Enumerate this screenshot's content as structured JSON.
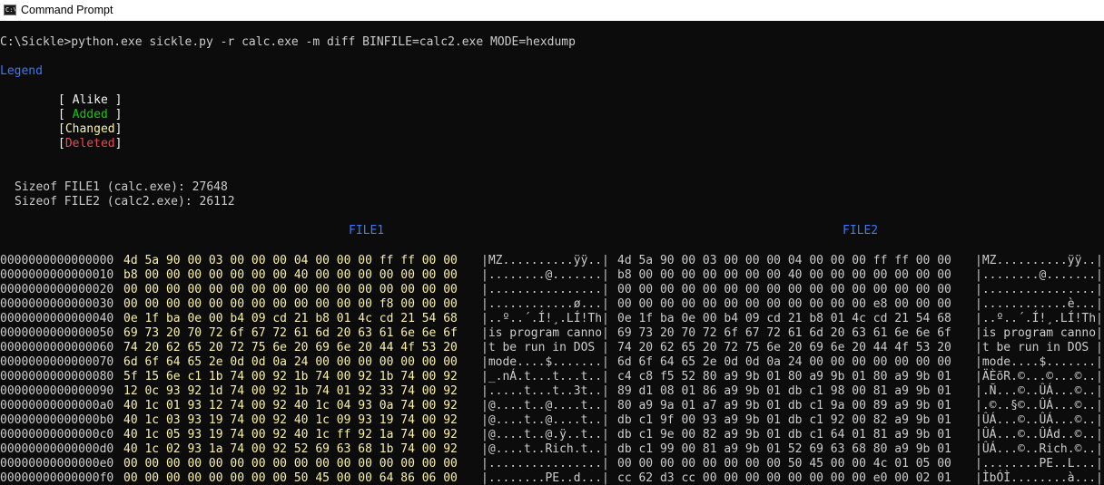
{
  "window": {
    "title": "Command Prompt",
    "icon": "console-icon"
  },
  "console": {
    "command": "C:\\Sickle>python.exe sickle.py -r calc.exe -m diff BINFILE=calc2.exe MODE=hexdump",
    "legend_heading": "Legend",
    "legend": {
      "alike": "[ Alike ]",
      "added": "[ Added ]",
      "changed": "[Changed]",
      "deleted": "[Deleted]"
    },
    "sizeof_file1": "Sizeof FILE1 (calc.exe): 27648",
    "sizeof_file2": "Sizeof FILE2 (calc2.exe): 26112",
    "file1_header": "FILE1",
    "file2_header": "FILE2"
  },
  "colors": {
    "background": "#0c0c0c",
    "text": "#cccccc",
    "legend_heading": "#3b78ff",
    "alike": "#f2f2f2",
    "added": "#16c60c",
    "changed": "#f9f1a5",
    "deleted": "#e74856"
  },
  "rows": [
    {
      "offset": "0000000000000000",
      "hex1": "4d 5a 90 00 03 00 00 00 04 00 00 00 ff ff 00 00",
      "ascii1": "|MZ..........ÿÿ..|",
      "hex2": "4d 5a 90 00 03 00 00 00 04 00 00 00 ff ff 00 00",
      "ascii2": "|MZ..........ÿÿ..|"
    },
    {
      "offset": "0000000000000010",
      "hex1": "b8 00 00 00 00 00 00 00 40 00 00 00 00 00 00 00",
      "ascii1": "|........@.......|",
      "hex2": "b8 00 00 00 00 00 00 00 40 00 00 00 00 00 00 00",
      "ascii2": "|........@.......|"
    },
    {
      "offset": "0000000000000020",
      "hex1": "00 00 00 00 00 00 00 00 00 00 00 00 00 00 00 00",
      "ascii1": "|................|",
      "hex2": "00 00 00 00 00 00 00 00 00 00 00 00 00 00 00 00",
      "ascii2": "|................|"
    },
    {
      "offset": "0000000000000030",
      "hex1": "00 00 00 00 00 00 00 00 00 00 00 00 f8 00 00 00",
      "ascii1": "|............ø...|",
      "hex2": "00 00 00 00 00 00 00 00 00 00 00 00 e8 00 00 00",
      "ascii2": "|............è...|"
    },
    {
      "offset": "0000000000000040",
      "hex1": "0e 1f ba 0e 00 b4 09 cd 21 b8 01 4c cd 21 54 68",
      "ascii1": "|..º..´.Í!¸.LÍ!Th|",
      "hex2": "0e 1f ba 0e 00 b4 09 cd 21 b8 01 4c cd 21 54 68",
      "ascii2": "|..º..´.Í!¸.LÍ!Th|"
    },
    {
      "offset": "0000000000000050",
      "hex1": "69 73 20 70 72 6f 67 72 61 6d 20 63 61 6e 6e 6f",
      "ascii1": "|is program canno|",
      "hex2": "69 73 20 70 72 6f 67 72 61 6d 20 63 61 6e 6e 6f",
      "ascii2": "|is program canno|"
    },
    {
      "offset": "0000000000000060",
      "hex1": "74 20 62 65 20 72 75 6e 20 69 6e 20 44 4f 53 20",
      "ascii1": "|t be run in DOS |",
      "hex2": "74 20 62 65 20 72 75 6e 20 69 6e 20 44 4f 53 20",
      "ascii2": "|t be run in DOS |"
    },
    {
      "offset": "0000000000000070",
      "hex1": "6d 6f 64 65 2e 0d 0d 0a 24 00 00 00 00 00 00 00",
      "ascii1": "|mode....$.......|",
      "hex2": "6d 6f 64 65 2e 0d 0d 0a 24 00 00 00 00 00 00 00",
      "ascii2": "|mode....$.......|"
    },
    {
      "offset": "0000000000000080",
      "hex1": "5f 15 6e c1 1b 74 00 92 1b 74 00 92 1b 74 00 92",
      "ascii1": "|_.nÁ.t...t...t..|",
      "hex2": "c4 c8 f5 52 80 a9 9b 01 80 a9 9b 01 80 a9 9b 01",
      "ascii2": "|ÄÈõR.©...©...©..|"
    },
    {
      "offset": "0000000000000090",
      "hex1": "12 0c 93 92 1d 74 00 92 1b 74 01 92 33 74 00 92",
      "ascii1": "|.....t...t..3t..|",
      "hex2": "89 d1 08 01 86 a9 9b 01 db c1 98 00 81 a9 9b 01",
      "ascii2": "|.Ñ...©..ÛÁ...©..|"
    },
    {
      "offset": "00000000000000a0",
      "hex1": "40 1c 01 93 12 74 00 92 40 1c 04 93 0a 74 00 92",
      "ascii1": "|@....t..@....t..|",
      "hex2": "80 a9 9a 01 a7 a9 9b 01 db c1 9a 00 89 a9 9b 01",
      "ascii2": "|.©..§©..ÛÁ...©..|"
    },
    {
      "offset": "00000000000000b0",
      "hex1": "40 1c 03 93 19 74 00 92 40 1c 09 93 19 74 00 92",
      "ascii1": "|@....t..@....t..|",
      "hex2": "db c1 9f 00 93 a9 9b 01 db c1 92 00 82 a9 9b 01",
      "ascii2": "|ÛÁ...©..ÛÁ...©..|"
    },
    {
      "offset": "00000000000000c0",
      "hex1": "40 1c 05 93 19 74 00 92 40 1c ff 92 1a 74 00 92",
      "ascii1": "|@....t..@.ÿ..t..|",
      "hex2": "db c1 9e 00 82 a9 9b 01 db c1 64 01 81 a9 9b 01",
      "ascii2": "|ÛÁ...©..ÛÁd..©..|"
    },
    {
      "offset": "00000000000000d0",
      "hex1": "40 1c 02 93 1a 74 00 92 52 69 63 68 1b 74 00 92",
      "ascii1": "|@....t..Rich.t..|",
      "hex2": "db c1 99 00 81 a9 9b 01 52 69 63 68 80 a9 9b 01",
      "ascii2": "|ÛÁ...©..Rich.©..|"
    },
    {
      "offset": "00000000000000e0",
      "hex1": "00 00 00 00 00 00 00 00 00 00 00 00 00 00 00 00",
      "ascii1": "|................|",
      "hex2": "00 00 00 00 00 00 00 00 50 45 00 00 4c 01 05 00",
      "ascii2": "|........PE..L...|"
    },
    {
      "offset": "00000000000000f0",
      "hex1": "00 00 00 00 00 00 00 00 50 45 00 00 64 86 06 00",
      "ascii1": "|........PE..d...|",
      "hex2": "cc 62 d3 cc 00 00 00 00 00 00 00 00 e0 00 02 01",
      "ascii2": "|ÌbÓÌ........à...|"
    }
  ]
}
